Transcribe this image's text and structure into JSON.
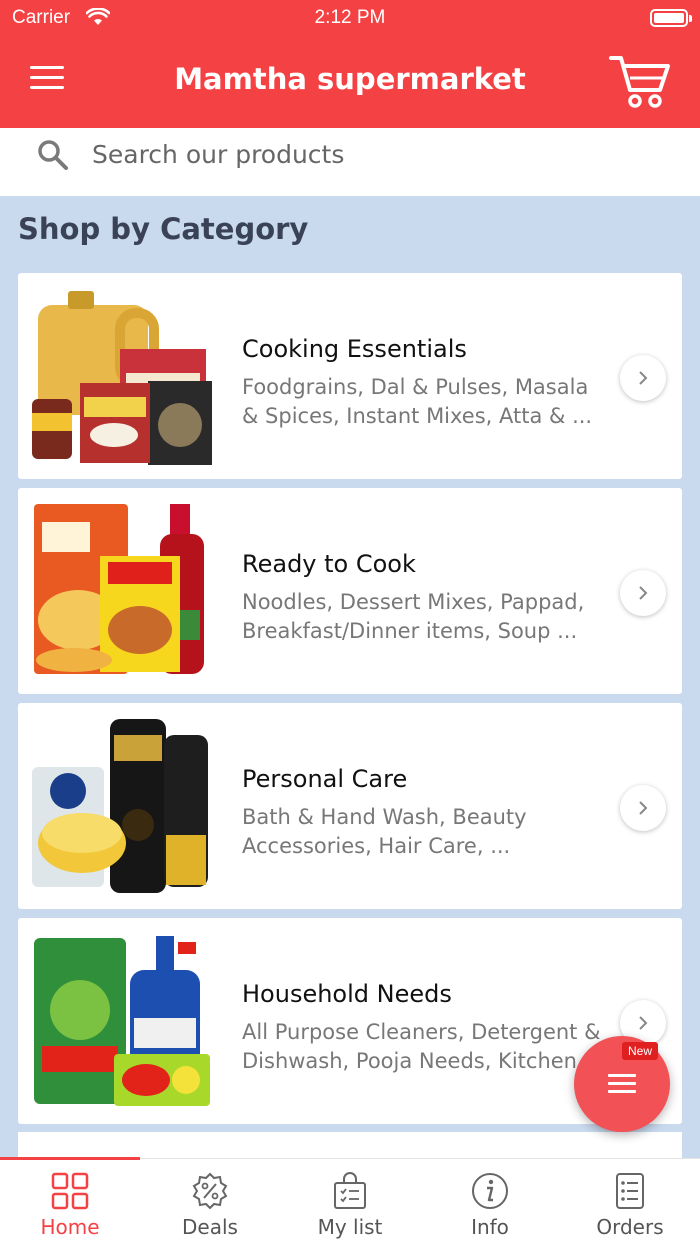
{
  "status_bar": {
    "carrier": "Carrier",
    "time": "2:12 PM"
  },
  "header": {
    "title": "Mamtha supermarket"
  },
  "search": {
    "placeholder": "Search our products"
  },
  "section_title": "Shop by Category",
  "categories": [
    {
      "title": "Cooking Essentials",
      "description": "Foodgrains, Dal & Pulses, Masala & Spices, Instant Mixes, Atta & ..."
    },
    {
      "title": "Ready to Cook",
      "description": "Noodles, Dessert Mixes, Pappad, Breakfast/Dinner items, Soup ..."
    },
    {
      "title": "Personal Care",
      "description": "Bath & Hand Wash, Beauty Accessories, Hair Care, ..."
    },
    {
      "title": "Household Needs",
      "description": "All Purpose Cleaners, Detergent & Dishwash, Pooja Needs, Kitchen..."
    }
  ],
  "fab": {
    "badge": "New"
  },
  "tabs": [
    {
      "label": "Home",
      "icon": "grid-icon",
      "active": true
    },
    {
      "label": "Deals",
      "icon": "deal-badge-icon"
    },
    {
      "label": "My list",
      "icon": "shopping-bag-list-icon"
    },
    {
      "label": "Info",
      "icon": "info-icon"
    },
    {
      "label": "Orders",
      "icon": "orders-list-icon"
    }
  ],
  "colors": {
    "brand": "#f44244",
    "background": "#c9d9ee",
    "fab": "#f25255"
  }
}
